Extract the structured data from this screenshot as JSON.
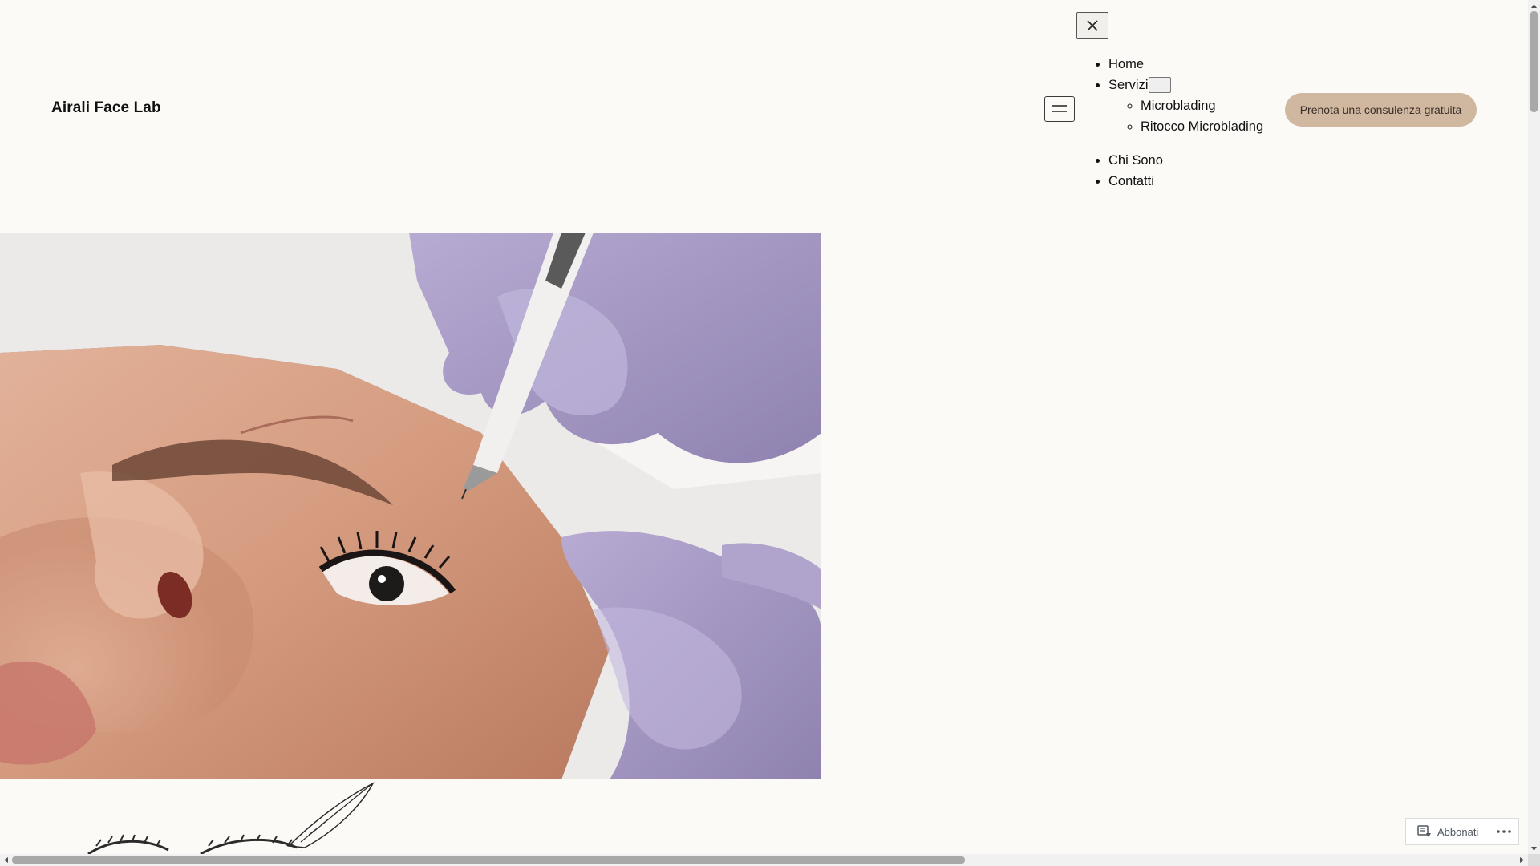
{
  "site": {
    "title": "Airali Face Lab"
  },
  "nav": {
    "items": [
      {
        "label": "Home"
      },
      {
        "label": "Servizi",
        "children": [
          {
            "label": "Microblading"
          },
          {
            "label": "Ritocco Microblading"
          }
        ]
      },
      {
        "label": "Chi Sono"
      },
      {
        "label": "Contatti"
      }
    ],
    "toggle_icon": "hamburger-icon",
    "close_icon": "close-icon"
  },
  "cta": {
    "label": "Prenota una consulenza gratuita",
    "color": "#cfb7a0"
  },
  "hero": {
    "image": "microblading-eyebrow-photo"
  },
  "subscribe_widget": {
    "label": "Abbonati",
    "icon": "reader-icon",
    "more_icon": "ellipsis-icon"
  },
  "colors": {
    "background": "#fbfaf6",
    "text": "#111111",
    "glove": "#a79bc4"
  }
}
